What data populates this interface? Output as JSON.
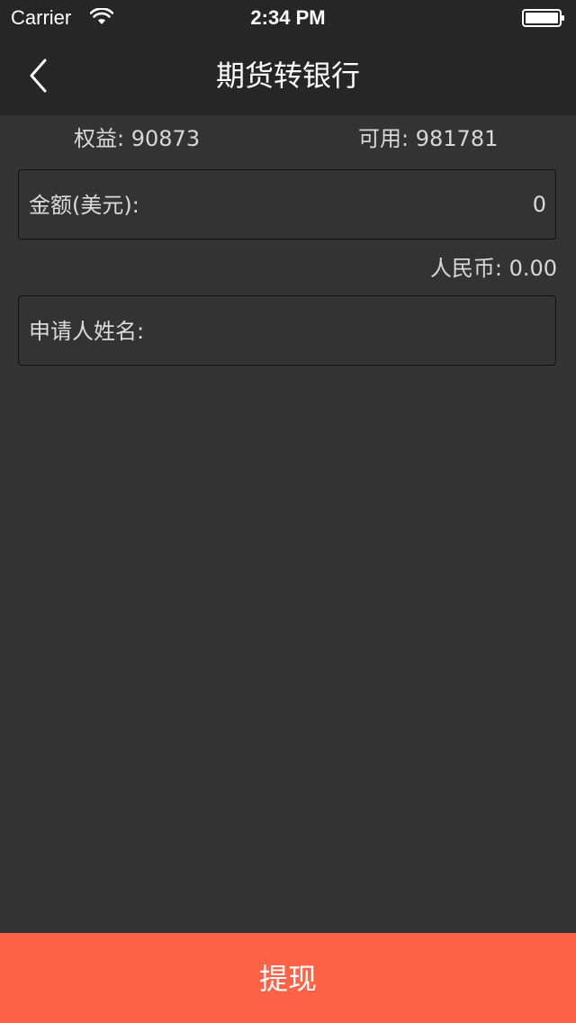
{
  "status_bar": {
    "carrier": "Carrier",
    "time": "2:34 PM",
    "wifi_icon": "wifi-icon",
    "battery_icon": "battery-icon"
  },
  "nav": {
    "title": "期货转银行",
    "back_icon": "chevron-left-icon"
  },
  "summary": {
    "equity_label": "权益:",
    "equity_value": "90873",
    "available_label": "可用:",
    "available_value": "981781"
  },
  "form": {
    "amount_label": "金额(美元):",
    "amount_value": "0",
    "rmb_label": "人民币:",
    "rmb_value": "0.00",
    "applicant_label": "申请人姓名:",
    "applicant_value": ""
  },
  "submit": {
    "label": "提现"
  },
  "colors": {
    "background": "#333333",
    "header": "#262626",
    "accent": "#ff6347"
  }
}
